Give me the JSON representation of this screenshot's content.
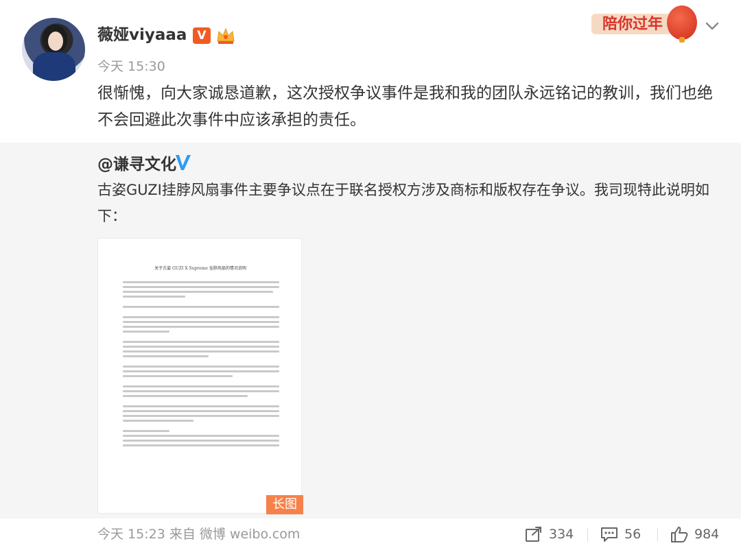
{
  "post": {
    "username": "薇娅viyaaa",
    "verified_badge": "V",
    "time": "今天 15:30",
    "text": "很惭愧，向大家诚恳道歉，这次授权争议事件是我和我的团队永远铭记的教训，我们也绝不会回避此次事件中应该承担的责任。",
    "newyear_banner": "陪你过年"
  },
  "repost": {
    "username": "@谦寻文化",
    "text": "古姿GUZI挂脖风扇事件主要争议点在于联名授权方涉及商标和版权存在争议。我司现特此说明如下：",
    "document_title": "关于古姿 GUZI X Supreme 挂脖风扇的情况说明",
    "long_image_badge": "长图"
  },
  "footer": {
    "time_source": "今天 15:23 来自 微博 weibo.com",
    "repost_count": "334",
    "comment_count": "56",
    "like_count": "984"
  },
  "icons": {
    "more": "chevron-down-icon",
    "repost": "share-icon",
    "comment": "comment-icon",
    "like": "thumbs-up-icon"
  },
  "colors": {
    "accent": "#f15a22",
    "repost_bg": "#f5f5f5",
    "long_badge": "#f5824b",
    "verified_blue": "#2e9cf3"
  }
}
